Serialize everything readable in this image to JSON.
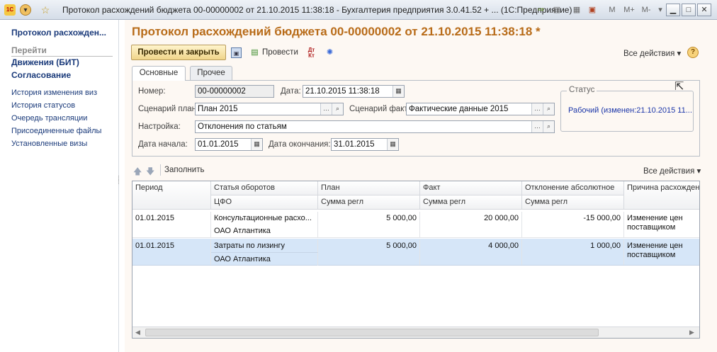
{
  "window": {
    "title": "Протокол расхождений бюджета 00-00000002 от 21.10.2015 11:38:18 - Бухгалтерия предприятия 3.0.41.52 + ...  (1С:Предприятие)",
    "app_logo": "1С",
    "mem_buttons": [
      "M",
      "M+",
      "M-"
    ]
  },
  "sidebar": {
    "title": "Протокол расхожден...",
    "section": "Перейти",
    "bold_links": [
      "Движения (БИТ)",
      "Согласование"
    ],
    "links": [
      "История изменения виз",
      "История статусов",
      "Очередь трансляции",
      "Присоединенные файлы",
      "Установленные визы"
    ]
  },
  "doc": {
    "title": "Протокол расхождений бюджета 00-00000002 от 21.10.2015 11:38:18 *"
  },
  "toolbar": {
    "post_close": "Провести и закрыть",
    "post": "Провести",
    "all_actions": "Все действия",
    "dtkt": "Дт Кт"
  },
  "tabs": [
    "Основные",
    "Прочее"
  ],
  "form": {
    "number_label": "Номер:",
    "number_value": "00-00000002",
    "date_label": "Дата:",
    "date_value": "21.10.2015 11:38:18",
    "plan_label": "Сценарий план:",
    "plan_value": "План 2015",
    "fact_label": "Сценарий факт:",
    "fact_value": "Фактические данные 2015",
    "setting_label": "Настройка:",
    "setting_value": "Отклонения по статьям",
    "start_label": "Дата начала:",
    "start_value": "01.01.2015",
    "end_label": "Дата окончания:",
    "end_value": "31.01.2015",
    "status_title": "Статус",
    "status_value": "Рабочий (изменен:21.10.2015 11..."
  },
  "table_toolbar": {
    "fill": "Заполнить",
    "all_actions": "Все действия"
  },
  "table": {
    "headers_row1": [
      "Период",
      "Статья оборотов",
      "План",
      "Факт",
      "Отклонение абсолютное",
      "Причина расхождени"
    ],
    "headers_row2": [
      "",
      "ЦФО",
      "Сумма регл",
      "Сумма регл",
      "Сумма регл",
      ""
    ],
    "rows": [
      {
        "period": "01.01.2015",
        "item": "Консультационные расхо...",
        "cfo": "ОАО Атлантика",
        "plan": "5 000,00",
        "fact": "20 000,00",
        "dev": "-15 000,00",
        "reason": "Изменение цен поставщиком"
      },
      {
        "period": "01.01.2015",
        "item": "Затраты по лизингу",
        "cfo": "ОАО Атлантика",
        "plan": "5 000,00",
        "fact": "4 000,00",
        "dev": "1 000,00",
        "reason": "Изменение цен поставщиком"
      }
    ]
  }
}
